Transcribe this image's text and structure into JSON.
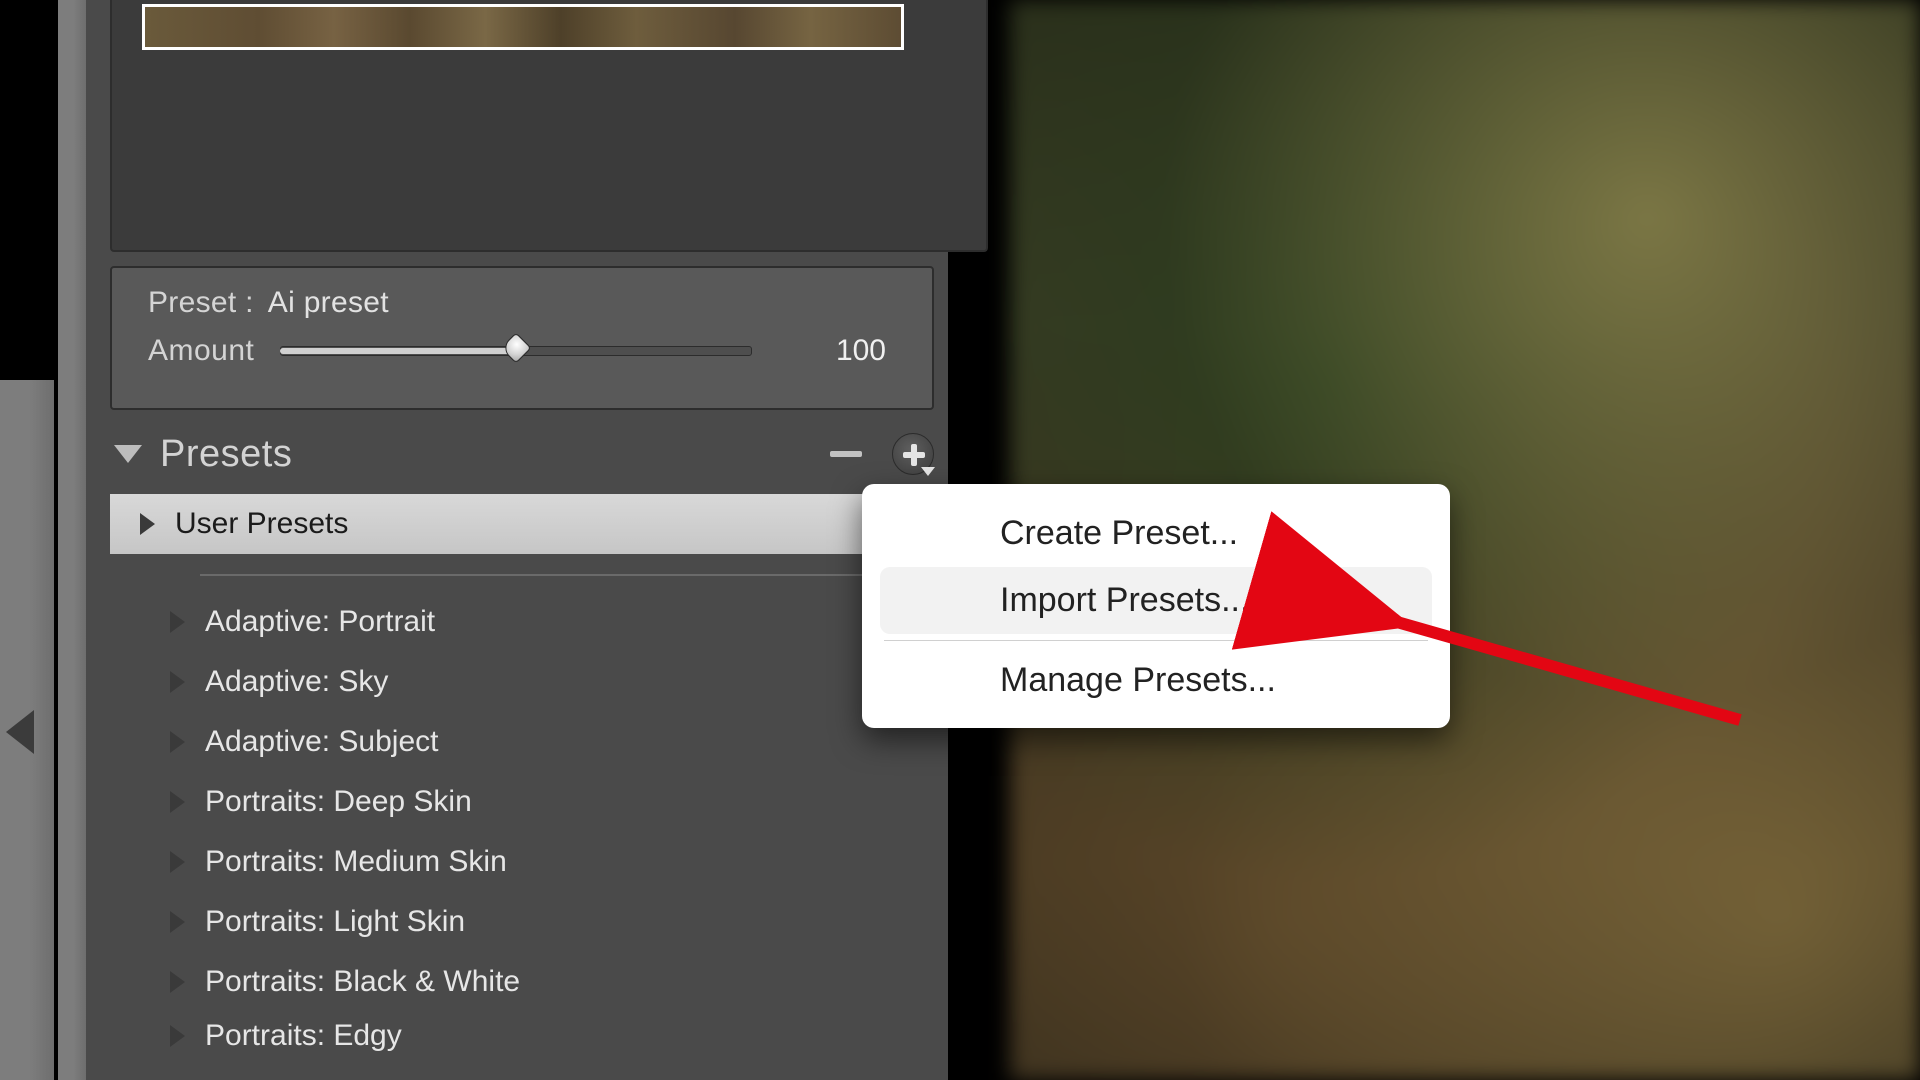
{
  "colors": {
    "panel_bg": "#4a4a4a",
    "panel_inset": "#595959",
    "text_light": "#e6e6e6",
    "menu_bg": "#ffffff",
    "annotation_red": "#e30613"
  },
  "preset_box": {
    "preset_label": "Preset :",
    "preset_name": "Ai preset",
    "amount_label": "Amount",
    "amount_value": "100",
    "amount_percent": 50
  },
  "presets_header": {
    "title": "Presets"
  },
  "preset_groups": {
    "selected": "User Presets",
    "items": [
      "Adaptive: Portrait",
      "Adaptive: Sky",
      "Adaptive: Subject",
      "Portraits: Deep Skin",
      "Portraits: Medium Skin",
      "Portraits: Light Skin",
      "Portraits: Black & White",
      "Portraits: Edgy"
    ]
  },
  "context_menu": {
    "create": "Create Preset...",
    "import": "Import Presets...",
    "manage": "Manage Presets..."
  }
}
